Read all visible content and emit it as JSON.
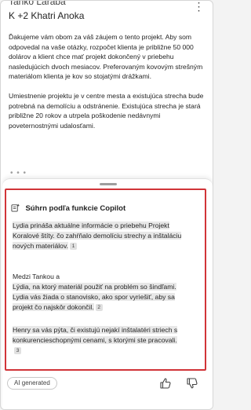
{
  "header": {
    "sender": "Tanko Laraba",
    "recipients": "K +2 Khatri Anoka",
    "more_label": "⋮"
  },
  "email": {
    "paragraphs": [
      "Ďakujeme vám obom za váš záujem o tento projekt. Aby som odpovedal na vaše otázky, rozpočet klienta je približne 50 000 dolárov a klient chce mať projekt dokončený v priebehu nasledujúcich dvoch mesiacov. Preferovaným kovovým strešným materiálom klienta je kov so stojatými drážkami.",
      "Umiestnenie projektu je v centre mesta a existujúca strecha bude potrebná na demolíciu a odstránenie. Existujúca strecha je stará približne 20 rokov a utrpela poškodenie nedávnymi poveternostnými udalosťami."
    ],
    "fade_indicator": "• • •"
  },
  "summary": {
    "title": "Súhrn podľa funkcie Copilot",
    "items": [
      {
        "text": "Lydia prináša aktuálne informácie o priebehu Projekt Koralové štíty. čo zahŕňalo demolíciu strechy a inštaláciu nových materiálov.",
        "citation": "1"
      },
      {
        "text_a": "Medzi Tankou a",
        "text_b": "Lýdia, na ktorý materiál použiť na problém so šindľami. Lydia vás žiada o stanovisko, ako spor vyriešiť, aby sa projekt čo najskôr dokončil.",
        "citation": "2"
      },
      {
        "text": "Henry sa vás pýta, či existujú nejakí inštalatéri striech s konkurencieschopnými cenami, s ktorými ste pracovali.",
        "citation": "3"
      }
    ]
  },
  "footer": {
    "ai_label": "AI generated"
  },
  "colors": {
    "highlight_border": "#d13438",
    "citation_bg": "#e0e0e0"
  },
  "icons": [
    "more-vertical-icon",
    "copilot-summary-icon",
    "thumbs-up-icon",
    "thumbs-down-icon"
  ]
}
